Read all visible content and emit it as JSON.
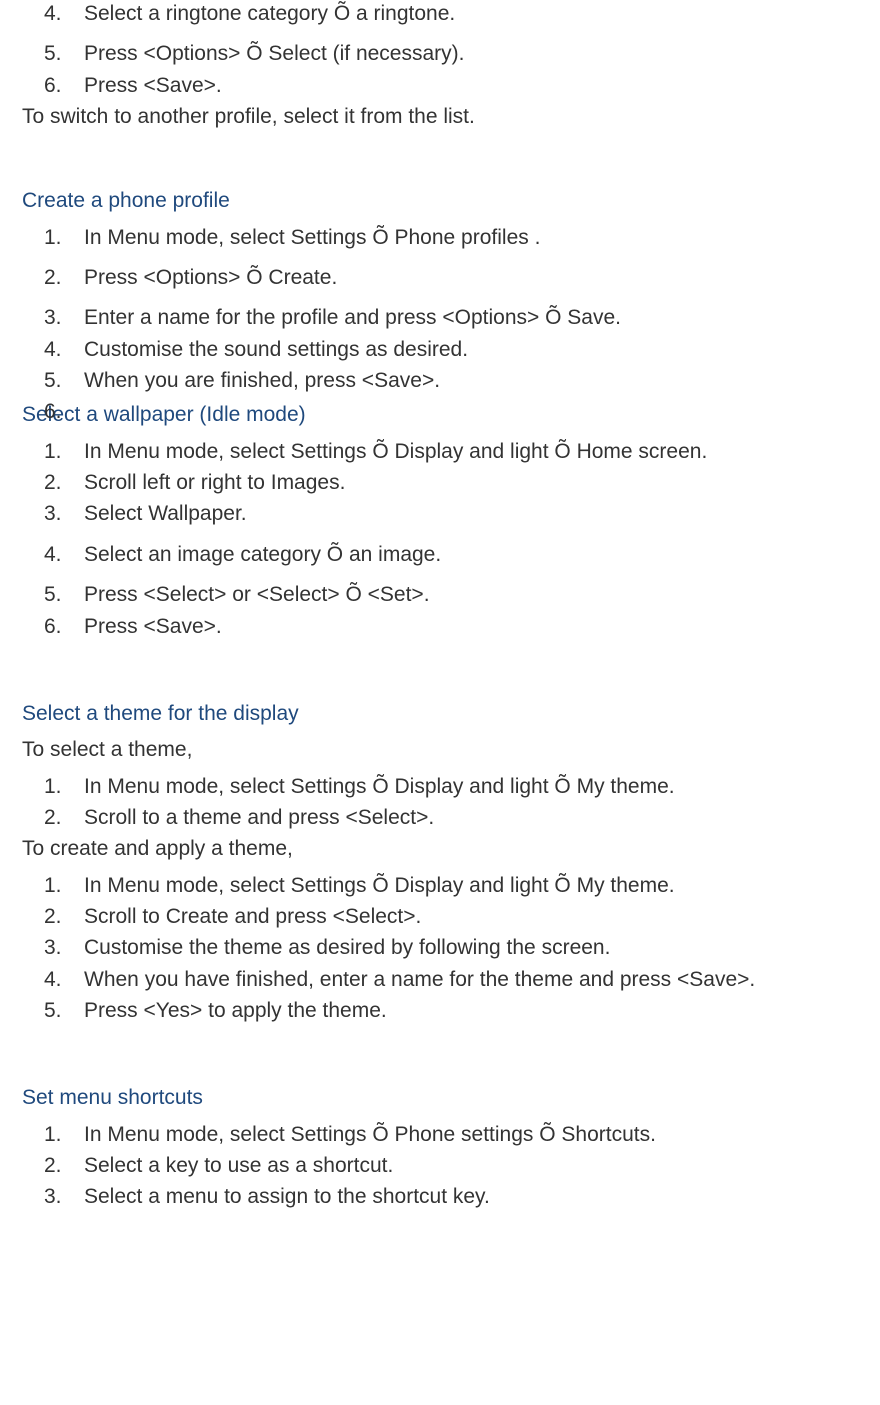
{
  "section0": {
    "items": [
      {
        "n": "4.",
        "t": "Select a ringtone category Õ a ringtone."
      },
      {
        "n": "5.",
        "t": "Press <Options> Õ Select (if necessary)."
      },
      {
        "n": "6.",
        "t": "Press <Save>."
      }
    ],
    "after": "To switch to another profile, select it from the list."
  },
  "section1": {
    "heading": "Create a phone profile",
    "items": [
      {
        "n": "1.",
        "t": "In Menu mode, select Settings Õ Phone profiles ."
      },
      {
        "n": "2.",
        "t": "Press <Options> Õ Create."
      },
      {
        "n": "3.",
        "t": "Enter a name for the profile and press <Options> Õ Save."
      },
      {
        "n": "4.",
        "t": "Customise the sound settings as desired."
      },
      {
        "n": "5.",
        "t": "When you are finished, press <Save>."
      },
      {
        "n": "6.",
        "t": ""
      }
    ]
  },
  "section2": {
    "heading": "Select a wallpaper (Idle mode)",
    "items": [
      {
        "n": "1.",
        "t": "In Menu mode, select Settings Õ Display and light Õ Home screen."
      },
      {
        "n": "2.",
        "t": "Scroll left or right to Images."
      },
      {
        "n": "3.",
        "t": "Select Wallpaper."
      },
      {
        "n": "4.",
        "t": "Select an image category Õ an image."
      },
      {
        "n": "5.",
        "t": "Press <Select> or <Select> Õ <Set>."
      },
      {
        "n": "6.",
        "t": "Press <Save>."
      }
    ]
  },
  "section3": {
    "heading": "Select a theme for the display",
    "intro": "To select a theme,",
    "items1": [
      {
        "n": "1.",
        "t": "In Menu mode, select Settings Õ Display and light Õ My theme."
      },
      {
        "n": "2.",
        "t": "Scroll to a theme and press <Select>."
      }
    ],
    "middle": "To create and apply a theme,",
    "items2": [
      {
        "n": "1.",
        "t": "In Menu mode, select Settings Õ Display and light Õ My theme."
      },
      {
        "n": "2.",
        "t": "Scroll to Create and press <Select>."
      },
      {
        "n": "3.",
        "t": "Customise the theme as desired by following the screen."
      },
      {
        "n": "4.",
        "t": "When you have finished, enter a name for the theme and press <Save>."
      },
      {
        "n": "5.",
        "t": "Press <Yes> to apply the theme."
      }
    ]
  },
  "section4": {
    "heading": "Set menu shortcuts",
    "items": [
      {
        "n": "1.",
        "t": "In Menu mode, select Settings Õ Phone settings Õ Shortcuts."
      },
      {
        "n": "2.",
        "t": "Select a key to use as a shortcut."
      },
      {
        "n": "3.",
        "t": "Select a menu to assign to the shortcut key."
      }
    ]
  }
}
